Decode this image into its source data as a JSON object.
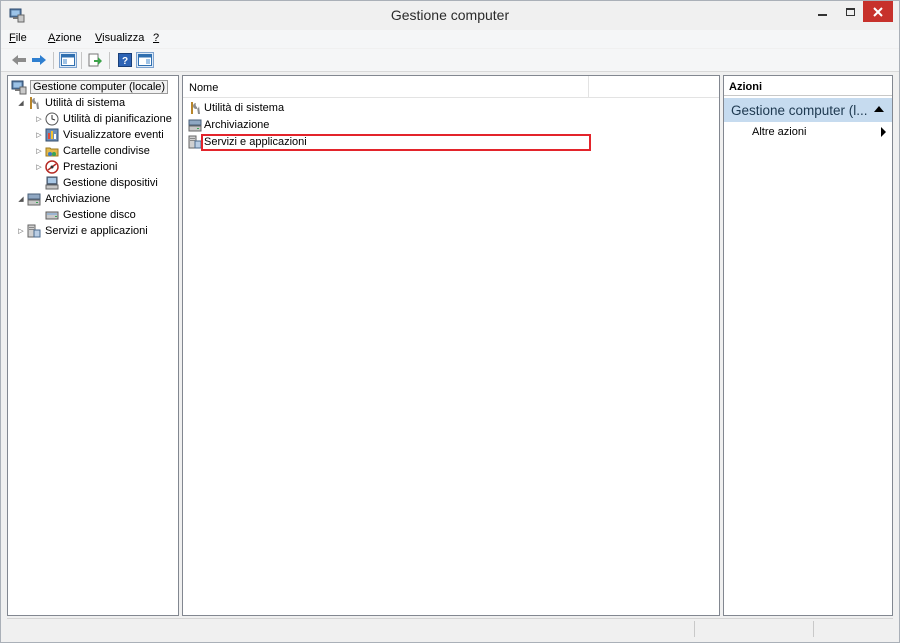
{
  "window": {
    "title": "Gestione computer"
  },
  "menu": [
    {
      "label": "File",
      "accel": "F",
      "rest": "ile"
    },
    {
      "label": "Azione",
      "accel": "A",
      "rest": "zione"
    },
    {
      "label": "Visualizza",
      "accel": "V",
      "rest": "isualizza"
    },
    {
      "label": "?",
      "accel": "?",
      "rest": ""
    }
  ],
  "toolbar": {
    "buttons": [
      "back-icon",
      "forward-icon",
      "show-hide-tree-icon",
      "export-list-icon",
      "help-icon",
      "show-hide-action-pane-icon"
    ]
  },
  "tree": {
    "root": "Gestione computer (locale)",
    "items": [
      {
        "label": "Utilità di sistema",
        "icon": "tools-icon",
        "expander": "expanded"
      },
      {
        "label": "Utilità di pianificazione",
        "icon": "clock-icon",
        "expander": "collapsed"
      },
      {
        "label": "Visualizzatore eventi",
        "icon": "event-viewer-icon",
        "expander": "collapsed"
      },
      {
        "label": "Cartelle condivise",
        "icon": "shared-folder-icon",
        "expander": "collapsed"
      },
      {
        "label": "Prestazioni",
        "icon": "performance-icon",
        "expander": "collapsed"
      },
      {
        "label": "Gestione dispositivi",
        "icon": "device-manager-icon",
        "expander": "none"
      },
      {
        "label": "Archiviazione",
        "icon": "storage-icon",
        "expander": "expanded"
      },
      {
        "label": "Gestione disco",
        "icon": "disk-icon",
        "expander": "none"
      },
      {
        "label": "Servizi e applicazioni",
        "icon": "services-icon",
        "expander": "collapsed"
      }
    ]
  },
  "list": {
    "column_name": "Nome",
    "rows": [
      {
        "label": "Utilità di sistema",
        "icon": "tools-icon"
      },
      {
        "label": "Archiviazione",
        "icon": "storage-icon"
      },
      {
        "label": "Servizi e applicazioni",
        "icon": "services-icon"
      }
    ]
  },
  "actions": {
    "header": "Azioni",
    "group": "Gestione computer (l...",
    "item": "Altre azioni"
  },
  "colors": {
    "accent": "#c6dbef",
    "close_button": "#c7312b",
    "highlight": "#e3242b"
  }
}
